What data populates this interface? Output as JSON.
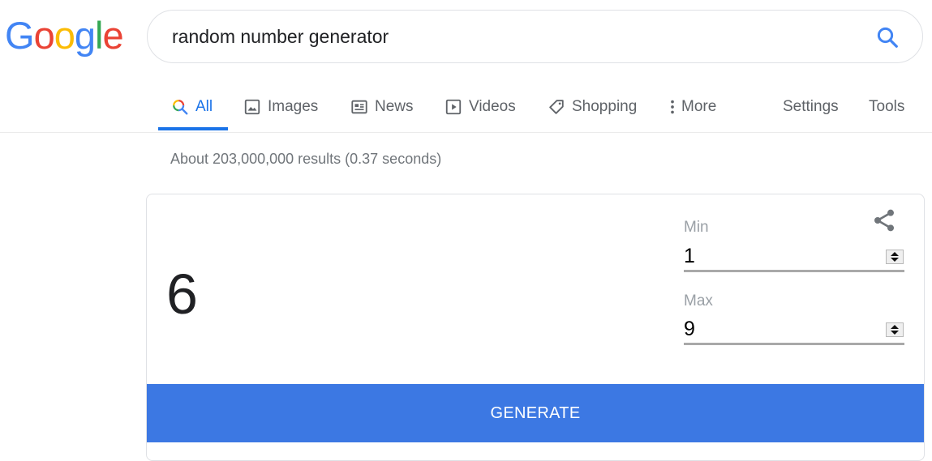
{
  "logo": {
    "letters": [
      "G",
      "o",
      "o",
      "g",
      "l",
      "e"
    ],
    "colors": [
      "#4285f4",
      "#ea4335",
      "#fbbc05",
      "#4285f4",
      "#34a853",
      "#ea4335"
    ]
  },
  "search": {
    "value": "random number generator",
    "icon": "search-icon"
  },
  "tabs": [
    {
      "label": "All",
      "icon": "search-icon",
      "active": true
    },
    {
      "label": "Images",
      "icon": "image-icon"
    },
    {
      "label": "News",
      "icon": "news-icon"
    },
    {
      "label": "Videos",
      "icon": "play-icon"
    },
    {
      "label": "Shopping",
      "icon": "tag-icon"
    },
    {
      "label": "More",
      "icon": "more-vertical-icon"
    },
    {
      "label": "Settings"
    },
    {
      "label": "Tools"
    }
  ],
  "result_stats": "About 203,000,000 results (0.37 seconds)",
  "rng": {
    "result": "6",
    "min_label": "Min",
    "min_value": "1",
    "max_label": "Max",
    "max_value": "9",
    "generate_label": "GENERATE",
    "button_color": "#3c78e3"
  },
  "colors": {
    "accent": "#1a73e8"
  }
}
